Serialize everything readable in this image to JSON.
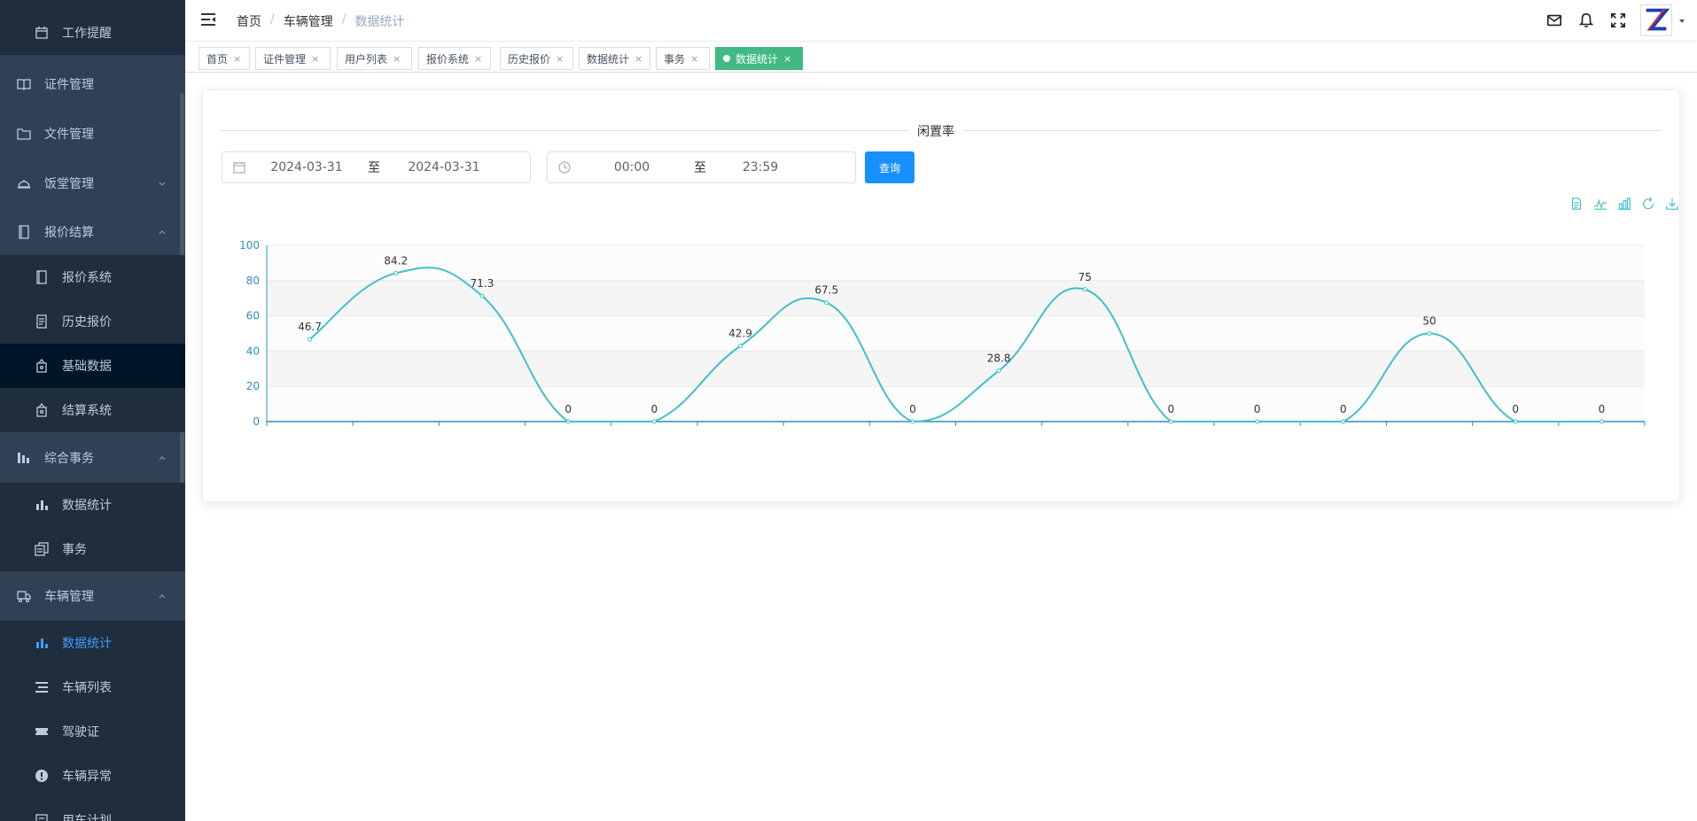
{
  "sidebar": {
    "items": [
      {
        "label": "工作提醒",
        "icon": "calendar-icon",
        "sub": true
      },
      {
        "label": "证件管理",
        "icon": "book-icon",
        "sub": false
      },
      {
        "label": "文件管理",
        "icon": "folder-icon",
        "sub": false
      },
      {
        "label": "饭堂管理",
        "icon": "dish-icon",
        "sub": false,
        "arrow": "down"
      },
      {
        "label": "报价结算",
        "icon": "notebook-icon",
        "sub": false,
        "arrow": "up"
      },
      {
        "label": "报价系统",
        "icon": "notebook-icon",
        "sub": true
      },
      {
        "label": "历史报价",
        "icon": "document-icon",
        "sub": true
      },
      {
        "label": "基础数据",
        "icon": "bag-icon",
        "sub": true,
        "dark": true
      },
      {
        "label": "结算系统",
        "icon": "bag-icon",
        "sub": true
      },
      {
        "label": "综合事务",
        "icon": "chart-icon",
        "sub": false,
        "arrow": "up"
      },
      {
        "label": "数据统计",
        "icon": "bar-chart-icon",
        "sub": true
      },
      {
        "label": "事务",
        "icon": "copy-icon",
        "sub": true
      },
      {
        "label": "车辆管理",
        "icon": "truck-icon",
        "sub": false,
        "arrow": "up"
      },
      {
        "label": "数据统计",
        "icon": "bar-chart-icon",
        "sub": true,
        "active": true
      },
      {
        "label": "车辆列表",
        "icon": "list-icon",
        "sub": true
      },
      {
        "label": "驾驶证",
        "icon": "ticket-icon",
        "sub": true
      },
      {
        "label": "车辆异常",
        "icon": "warning-icon",
        "sub": true
      },
      {
        "label": "用车计划",
        "icon": "plan-icon",
        "sub": true
      }
    ]
  },
  "navbar": {
    "breadcrumb": [
      "首页",
      "车辆管理",
      "数据统计"
    ]
  },
  "tags": [
    {
      "label": "首页"
    },
    {
      "label": "证件管理"
    },
    {
      "label": "用户列表"
    },
    {
      "label": "报价系统"
    },
    {
      "label": "历史报价"
    },
    {
      "label": "数据统计"
    },
    {
      "label": "事务"
    },
    {
      "label": "数据统计",
      "active": true
    }
  ],
  "filters": {
    "title": "闲置率",
    "date_start": "2024-03-31",
    "date_end": "2024-03-31",
    "date_sep": "至",
    "time_start": "00:00",
    "time_end": "23:59",
    "time_sep": "至",
    "query_label": "查询"
  },
  "colors": {
    "line": "#3fc1c9",
    "primary": "#1890ff",
    "tag_active": "#42b983",
    "sidebar_bg": "#304156",
    "sidebar_sub": "#1f2d3d",
    "sidebar_dark": "#001528",
    "sidebar_active_text": "#409eff"
  },
  "chart_data": {
    "type": "line",
    "smooth": true,
    "ylim": [
      0,
      100
    ],
    "yticks": [
      0,
      20,
      40,
      60,
      80,
      100
    ],
    "categories": [
      "",
      "",
      "",
      "",
      "",
      "",
      "",
      "",
      "",
      "",
      "",
      "",
      "",
      "",
      "",
      "",
      ""
    ],
    "series": [
      {
        "values": [
          46.7,
          84.2,
          71.3,
          0,
          0,
          42.9,
          67.5,
          0,
          28.8,
          75,
          0,
          0,
          0,
          50,
          0,
          0
        ]
      }
    ],
    "data_labels": [
      "46.7",
      "84.2",
      "71.3",
      "0",
      "0",
      "42.9",
      "67.5",
      "0",
      "28.8",
      "75",
      "0",
      "0",
      "0",
      "50",
      "0",
      "0"
    ],
    "grid_bands": true,
    "legend": "none"
  }
}
